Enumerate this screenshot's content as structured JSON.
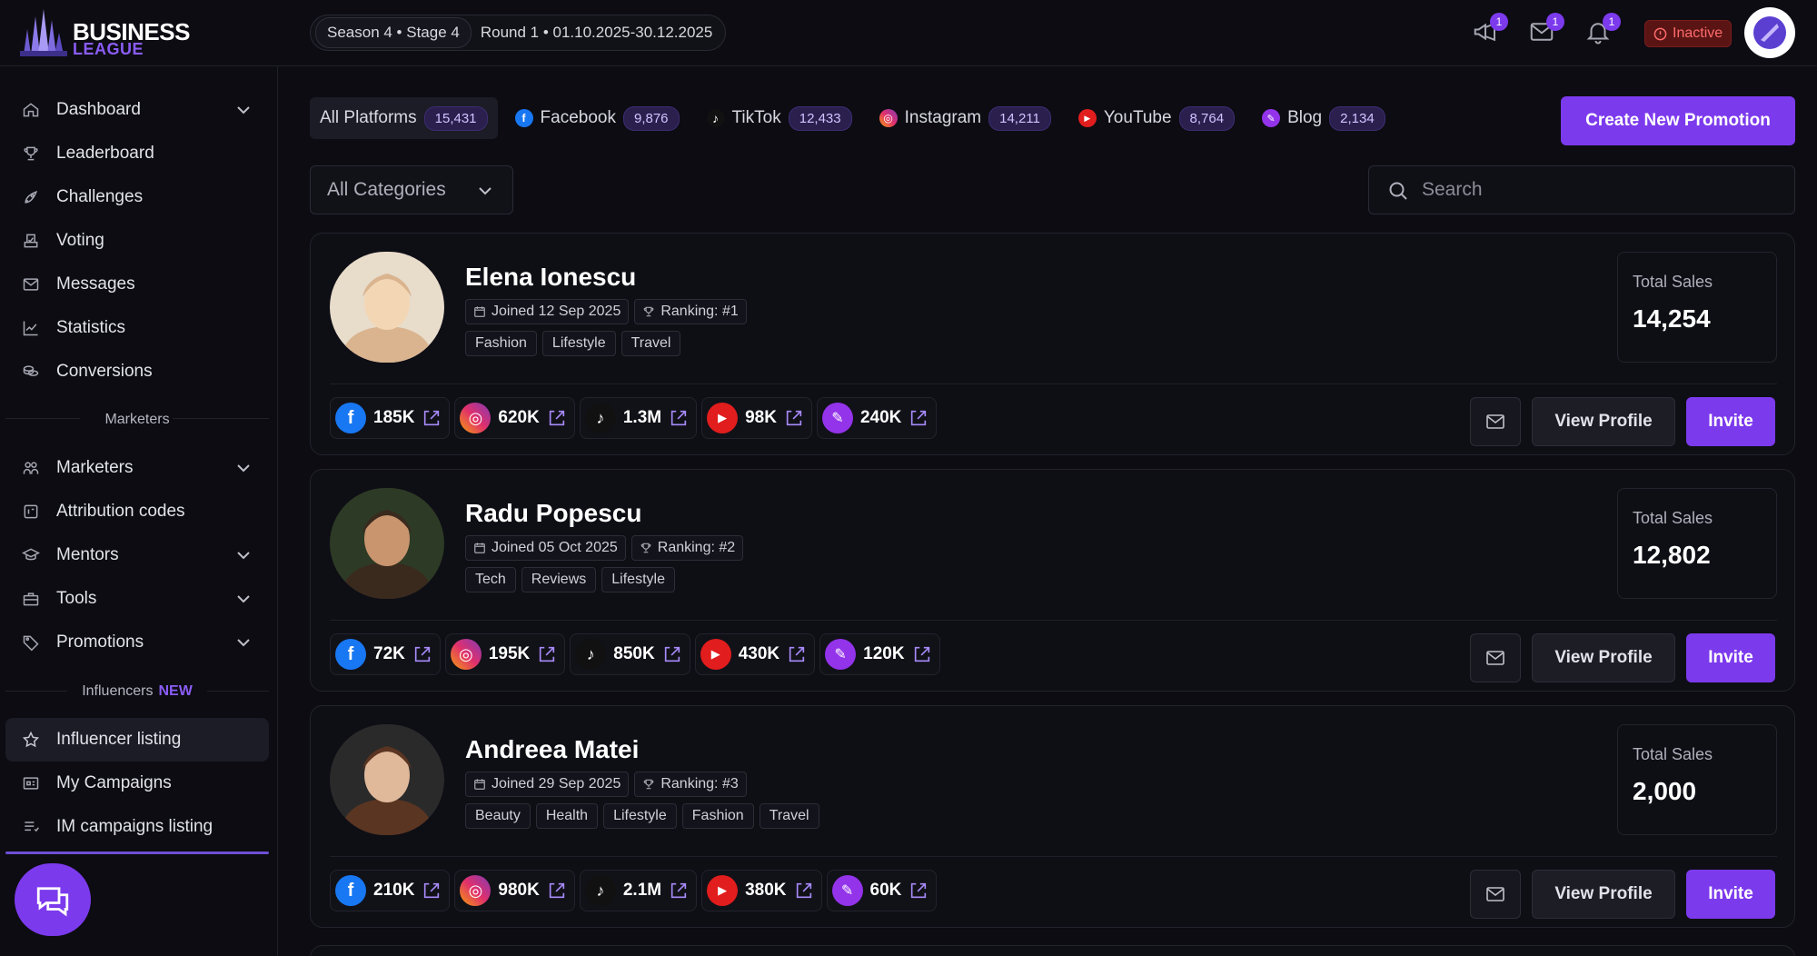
{
  "header": {
    "logo_line1": "BUSINESS",
    "logo_line2": "LEAGUE",
    "season": "Season 4 • Stage 4",
    "round": "Round 1 • 01.10.2025-30.12.2025",
    "badges": {
      "announcements": "1",
      "messages": "1",
      "notifications": "1"
    },
    "status": "Inactive"
  },
  "sidebar": {
    "items_main": [
      {
        "label": "Dashboard",
        "icon": "home-icon",
        "expandable": true
      },
      {
        "label": "Leaderboard",
        "icon": "trophy-icon",
        "expandable": false
      },
      {
        "label": "Challenges",
        "icon": "rocket-icon",
        "expandable": false
      },
      {
        "label": "Voting",
        "icon": "vote-icon",
        "expandable": false
      },
      {
        "label": "Messages",
        "icon": "mail-icon",
        "expandable": false
      },
      {
        "label": "Statistics",
        "icon": "chart-icon",
        "expandable": false
      },
      {
        "label": "Conversions",
        "icon": "coins-icon",
        "expandable": false
      }
    ],
    "section_marketers": "Marketers",
    "items_marketers": [
      {
        "label": "Marketers",
        "icon": "users-icon",
        "expandable": true
      },
      {
        "label": "Attribution codes",
        "icon": "code-icon",
        "expandable": false
      },
      {
        "label": "Mentors",
        "icon": "mortarboard-icon",
        "expandable": true
      },
      {
        "label": "Tools",
        "icon": "toolbox-icon",
        "expandable": true
      },
      {
        "label": "Promotions",
        "icon": "tag-icon",
        "expandable": true
      }
    ],
    "section_influencers": "Influencers",
    "section_influencers_badge": "NEW",
    "items_influencers": [
      {
        "label": "Influencer listing",
        "icon": "star-icon",
        "active": true
      },
      {
        "label": "My Campaigns",
        "icon": "campaign-icon",
        "active": false
      },
      {
        "label": "IM campaigns listing",
        "icon": "list-icon",
        "active": false
      }
    ]
  },
  "platforms": [
    {
      "label": "All Platforms",
      "count": "15,431",
      "active": true,
      "icon": ""
    },
    {
      "label": "Facebook",
      "count": "9,876",
      "active": false,
      "icon": "facebook-icon"
    },
    {
      "label": "TikTok",
      "count": "12,433",
      "active": false,
      "icon": "tiktok-icon"
    },
    {
      "label": "Instagram",
      "count": "14,211",
      "active": false,
      "icon": "instagram-icon"
    },
    {
      "label": "YouTube",
      "count": "8,764",
      "active": false,
      "icon": "youtube-icon"
    },
    {
      "label": "Blog",
      "count": "2,134",
      "active": false,
      "icon": "blog-icon"
    }
  ],
  "create_button": "Create New Promotion",
  "category_select": "All Categories",
  "search_placeholder": "Search",
  "colors": {
    "accent": "#7c3aed",
    "facebook": "#1877f2",
    "youtube": "#e11d1d",
    "blog": "#9333ea",
    "inactive": "#ff6b6b"
  },
  "influencers": [
    {
      "name": "Elena Ionescu",
      "joined": "Joined 12 Sep 2025",
      "ranking": "Ranking: #1",
      "tags": [
        "Fashion",
        "Lifestyle",
        "Travel"
      ],
      "sales_label": "Total Sales",
      "sales_value": "14,254",
      "socials": [
        {
          "platform": "facebook",
          "value": "185K"
        },
        {
          "platform": "instagram",
          "value": "620K"
        },
        {
          "platform": "tiktok",
          "value": "1.3M"
        },
        {
          "platform": "youtube",
          "value": "98K"
        },
        {
          "platform": "blog",
          "value": "240K"
        }
      ],
      "view_label": "View Profile",
      "invite_label": "Invite"
    },
    {
      "name": "Radu Popescu",
      "joined": "Joined 05 Oct 2025",
      "ranking": "Ranking: #2",
      "tags": [
        "Tech",
        "Reviews",
        "Lifestyle"
      ],
      "sales_label": "Total Sales",
      "sales_value": "12,802",
      "socials": [
        {
          "platform": "facebook",
          "value": "72K"
        },
        {
          "platform": "instagram",
          "value": "195K"
        },
        {
          "platform": "tiktok",
          "value": "850K"
        },
        {
          "platform": "youtube",
          "value": "430K"
        },
        {
          "platform": "blog",
          "value": "120K"
        }
      ],
      "view_label": "View Profile",
      "invite_label": "Invite"
    },
    {
      "name": "Andreea Matei",
      "joined": "Joined 29 Sep 2025",
      "ranking": "Ranking: #3",
      "tags": [
        "Beauty",
        "Health",
        "Lifestyle",
        "Fashion",
        "Travel"
      ],
      "sales_label": "Total Sales",
      "sales_value": "2,000",
      "socials": [
        {
          "platform": "facebook",
          "value": "210K"
        },
        {
          "platform": "instagram",
          "value": "980K"
        },
        {
          "platform": "tiktok",
          "value": "2.1M"
        },
        {
          "platform": "youtube",
          "value": "380K"
        },
        {
          "platform": "blog",
          "value": "60K"
        }
      ],
      "view_label": "View Profile",
      "invite_label": "Invite"
    }
  ]
}
